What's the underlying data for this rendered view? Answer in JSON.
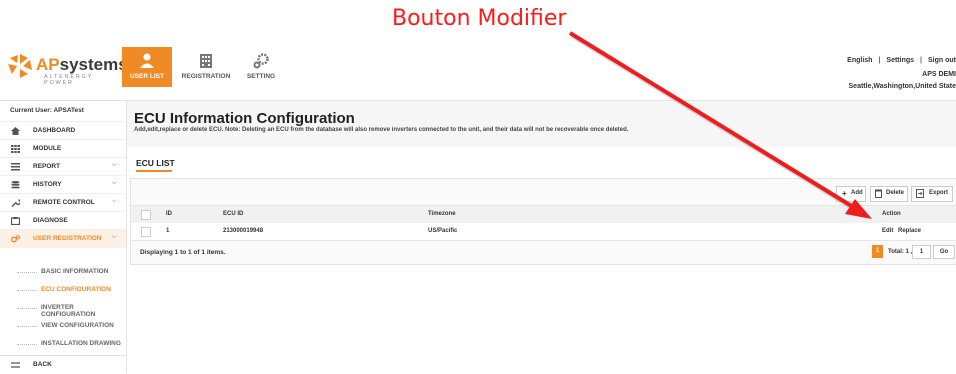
{
  "annotation": {
    "label": "Bouton Modifier"
  },
  "brand": {
    "name_a": "AP",
    "name_b": "systems",
    "tagline": "ALTENERGY POWER",
    "accent": "#f08a24"
  },
  "top_nav": {
    "tabs": [
      {
        "label": "USER LIST"
      },
      {
        "label": "REGISTRATION"
      },
      {
        "label": "SETTING"
      }
    ]
  },
  "top_right": {
    "language": "English",
    "settings": "Settings",
    "sign_out": "Sign out",
    "account": "APS DEMI",
    "location": "Seattle,Washington,United State"
  },
  "sidebar": {
    "current_user": "Current User: APSATest",
    "items": [
      {
        "label": "DASHBOARD",
        "icon": "home-icon"
      },
      {
        "label": "MODULE",
        "icon": "grid-icon"
      },
      {
        "label": "REPORT",
        "icon": "report-icon",
        "chevron": "⌵"
      },
      {
        "label": "HISTORY",
        "icon": "database-icon",
        "chevron": "⌵"
      },
      {
        "label": "REMOTE CONTROL",
        "icon": "wrench-icon",
        "chevron": "⌵"
      },
      {
        "label": "DIAGNOSE",
        "icon": "diagnose-icon"
      },
      {
        "label": "USER REGISTRATION",
        "icon": "gears-icon",
        "chevron": "⌵"
      }
    ],
    "subitems": [
      {
        "label": "BASIC INFORMATION"
      },
      {
        "label": "ECU CONFIGURATION"
      },
      {
        "label": "INVERTER CONFIGURATION"
      },
      {
        "label": "VIEW CONFIGURATION"
      },
      {
        "label": "INSTALLATION DRAWING"
      }
    ],
    "back": {
      "label": "BACK",
      "icon": "back-arrow-icon"
    }
  },
  "main": {
    "title": "ECU Information Configuration",
    "description": "Add,edit,replace or delete ECU. Note: Deleting an ECU from the database will also remove inverters connected to the unit, and their data will not be recoverable once deleted.",
    "list_title": "ECU LIST",
    "toolbar": {
      "add": "Add",
      "delete": "Delete",
      "export": "Export"
    },
    "table": {
      "headers": [
        "ID",
        "ECU ID",
        "Timezone",
        "Action"
      ],
      "rows": [
        {
          "id": "1",
          "ecu_id": "213000019948",
          "timezone": "US/Pacific",
          "edit": "Edit",
          "replace": "Replace"
        }
      ]
    },
    "pagination": {
      "info": "Displaying 1 to 1 of 1 items.",
      "page": "1",
      "total": "Total: 1 , Go to",
      "goto_value": "1",
      "go": "Go"
    }
  }
}
